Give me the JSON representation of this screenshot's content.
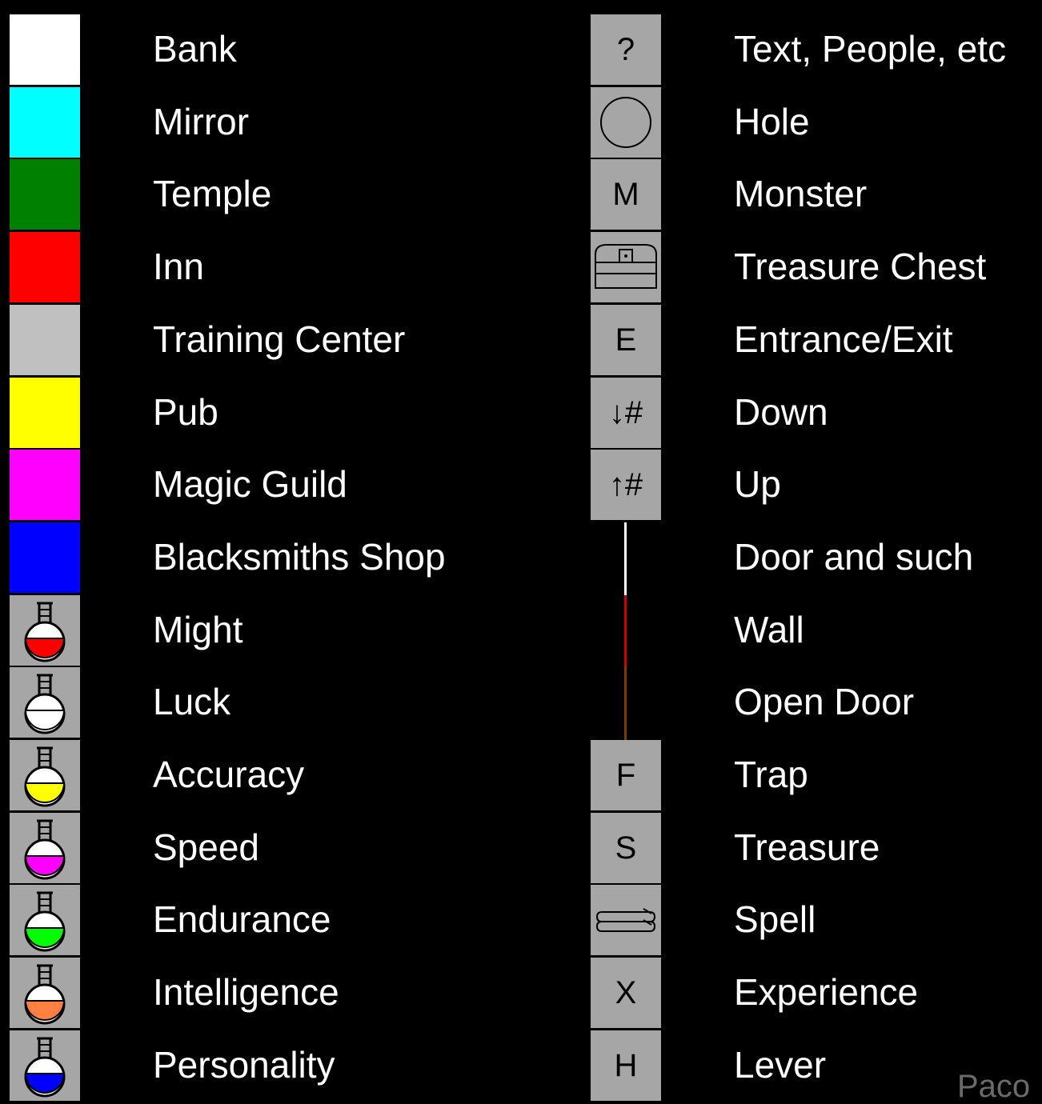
{
  "left_legend": [
    {
      "label": "Bank",
      "kind": "swatch",
      "color": "#ffffff"
    },
    {
      "label": "Mirror",
      "kind": "swatch",
      "color": "#00ffff"
    },
    {
      "label": "Temple",
      "kind": "swatch",
      "color": "#008000"
    },
    {
      "label": "Inn",
      "kind": "swatch",
      "color": "#ff0000"
    },
    {
      "label": "Training Center",
      "kind": "swatch",
      "color": "#c0c0c0"
    },
    {
      "label": "Pub",
      "kind": "swatch",
      "color": "#ffff00"
    },
    {
      "label": "Magic Guild",
      "kind": "swatch",
      "color": "#ff00ff"
    },
    {
      "label": "Blacksmiths Shop",
      "kind": "swatch",
      "color": "#0000ff"
    },
    {
      "label": "Might",
      "kind": "flask",
      "color": "#ff0000",
      "icon": "potion-flask-icon"
    },
    {
      "label": "Luck",
      "kind": "flask",
      "color": "#ffffff",
      "icon": "potion-flask-icon"
    },
    {
      "label": "Accuracy",
      "kind": "flask",
      "color": "#ffff00",
      "icon": "potion-flask-icon"
    },
    {
      "label": "Speed",
      "kind": "flask",
      "color": "#ff00ff",
      "icon": "potion-flask-icon"
    },
    {
      "label": "Endurance",
      "kind": "flask",
      "color": "#00ff00",
      "icon": "potion-flask-icon"
    },
    {
      "label": "Intelligence",
      "kind": "flask",
      "color": "#ff8040",
      "icon": "potion-flask-icon"
    },
    {
      "label": "Personality",
      "kind": "flask",
      "color": "#0000ff",
      "icon": "potion-flask-icon"
    }
  ],
  "right_legend": [
    {
      "label": "Text, People, etc",
      "kind": "symbol",
      "symbol": "?",
      "icon": "question-mark-icon"
    },
    {
      "label": "Hole",
      "kind": "svg",
      "icon": "hole-circle-icon"
    },
    {
      "label": "Monster",
      "kind": "symbol",
      "symbol": "M",
      "icon": "monster-letter-icon"
    },
    {
      "label": "Treasure Chest",
      "kind": "svg",
      "icon": "treasure-chest-icon"
    },
    {
      "label": "Entrance/Exit",
      "kind": "symbol",
      "symbol": "E",
      "icon": "entrance-letter-icon"
    },
    {
      "label": "Down",
      "kind": "symbol",
      "symbol": "↓#",
      "icon": "down-arrow-icon"
    },
    {
      "label": "Up",
      "kind": "symbol",
      "symbol": "↑#",
      "icon": "up-arrow-icon"
    },
    {
      "label": "Door and such",
      "kind": "line",
      "color": "#ffffff",
      "icon": "door-line-icon"
    },
    {
      "label": "Wall",
      "kind": "line",
      "color": "#cc0000",
      "icon": "wall-line-icon"
    },
    {
      "label": "Open Door",
      "kind": "line",
      "color": "#7a3c00",
      "icon": "open-door-line-icon"
    },
    {
      "label": "Trap",
      "kind": "symbol",
      "symbol": "F",
      "icon": "trap-letter-icon"
    },
    {
      "label": "Treasure",
      "kind": "symbol",
      "symbol": "S",
      "icon": "treasure-letter-icon"
    },
    {
      "label": "Spell",
      "kind": "svg",
      "icon": "spell-scroll-icon"
    },
    {
      "label": "Experience",
      "kind": "symbol",
      "symbol": "X",
      "icon": "experience-letter-icon"
    },
    {
      "label": "Lever",
      "kind": "symbol",
      "symbol": "H",
      "icon": "lever-letter-icon"
    }
  ],
  "watermark": "Paco"
}
